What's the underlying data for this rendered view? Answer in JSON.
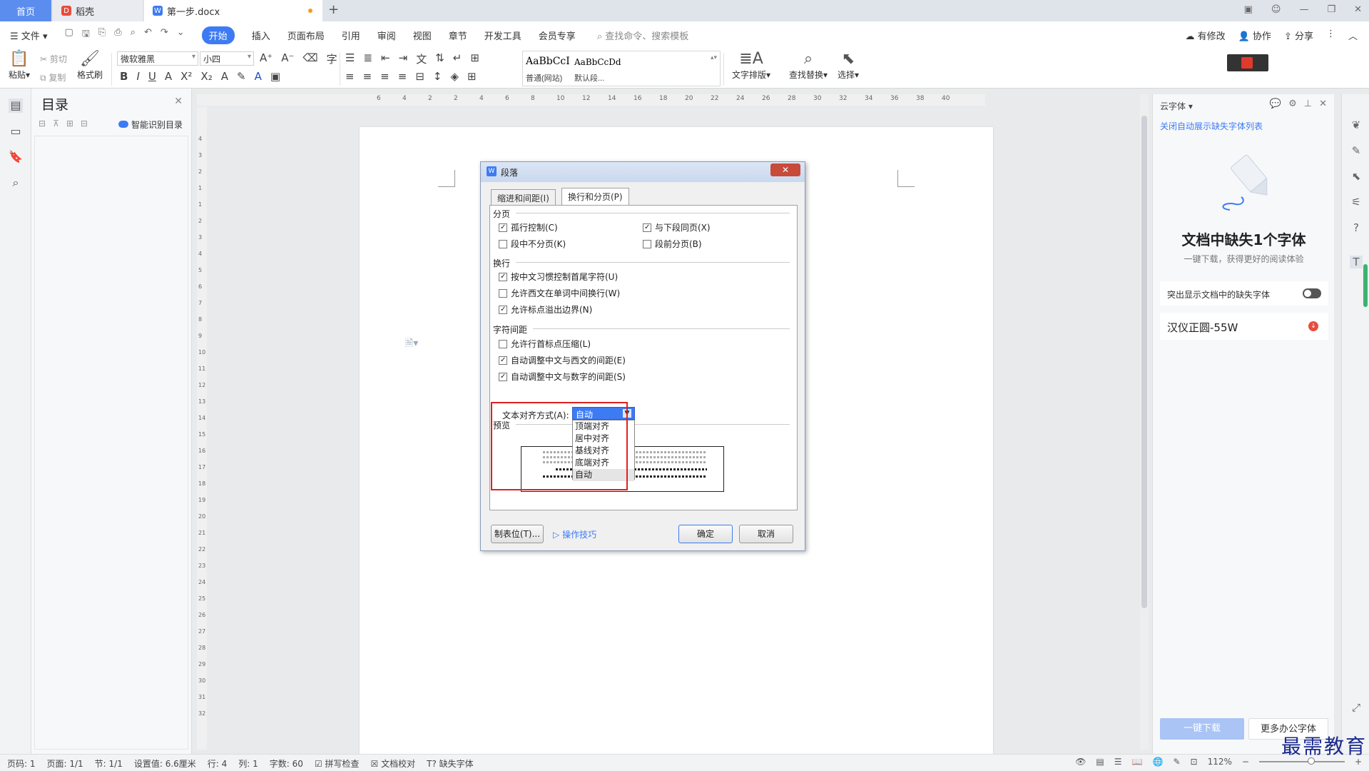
{
  "tabs": {
    "home": "首页",
    "shell": "稻壳",
    "doc": "第一步.docx",
    "add": "+"
  },
  "menu": {
    "file": "文件",
    "items": [
      "开始",
      "插入",
      "页面布局",
      "引用",
      "审阅",
      "视图",
      "章节",
      "开发工具",
      "会员专享"
    ],
    "active": "开始",
    "search_placeholder": "查找命令、搜索模板",
    "right": {
      "modified": "有修改",
      "collab": "协作",
      "share": "分享"
    }
  },
  "ribbon": {
    "paste": "粘贴",
    "cut": "剪切",
    "copy": "复制",
    "format_painter": "格式刷",
    "font_name": "微软雅黑",
    "font_size": "小四",
    "bold": "B",
    "italic": "I",
    "underline": "U",
    "styles": [
      {
        "sample": "AaBbCcI",
        "name": "普通(网站)"
      },
      {
        "sample": "AaBbCcDd",
        "name": "默认段..."
      }
    ],
    "text_layout": "文字排版",
    "find_replace": "查找替换",
    "select": "选择"
  },
  "toc": {
    "title": "目录",
    "smart": "智能识别目录"
  },
  "ruler_h": [
    "6",
    "4",
    "2",
    "2",
    "4",
    "6",
    "8",
    "10",
    "12",
    "14",
    "16",
    "18",
    "20",
    "22",
    "24",
    "26",
    "28",
    "30",
    "32",
    "34",
    "36",
    "38",
    "40"
  ],
  "ruler_v": [
    "4",
    "3",
    "2",
    "1",
    "1",
    "2",
    "3",
    "4",
    "5",
    "6",
    "7",
    "8",
    "9",
    "10",
    "11",
    "12",
    "13",
    "14",
    "15",
    "16",
    "17",
    "18",
    "19",
    "20",
    "21",
    "22",
    "23",
    "24",
    "25",
    "26",
    "27",
    "28",
    "29",
    "30",
    "31",
    "32"
  ],
  "dialog": {
    "title": "段落",
    "close": "✕",
    "tabs": [
      "缩进和间距(I)",
      "换行和分页(P)"
    ],
    "sections": {
      "pagination": "分页",
      "linebreak": "换行",
      "charspacing": "字符间距",
      "preview": "预览"
    },
    "checks": {
      "widow": {
        "label": "孤行控制(C)",
        "checked": true
      },
      "keep_next": {
        "label": "与下段同页(X)",
        "checked": true
      },
      "keep_lines": {
        "label": "段中不分页(K)",
        "checked": false
      },
      "page_before": {
        "label": "段前分页(B)",
        "checked": false
      },
      "cn_rules": {
        "label": "按中文习惯控制首尾字符(U)",
        "checked": true
      },
      "word_wrap": {
        "label": "允许西文在单词中间换行(W)",
        "checked": false
      },
      "punct_overflow": {
        "label": "允许标点溢出边界(N)",
        "checked": true
      },
      "compress_punct": {
        "label": "允许行首标点压缩(L)",
        "checked": false
      },
      "auto_cn_en": {
        "label": "自动调整中文与西文的间距(E)",
        "checked": true
      },
      "auto_cn_num": {
        "label": "自动调整中文与数字的间距(S)",
        "checked": true
      }
    },
    "align_label": "文本对齐方式(A):",
    "align_value": "自动",
    "align_options": [
      "顶端对齐",
      "居中对齐",
      "基线对齐",
      "底端对齐",
      "自动"
    ],
    "buttons": {
      "tabs": "制表位(T)...",
      "tips": "操作技巧",
      "ok": "确定",
      "cancel": "取消"
    }
  },
  "right_panel": {
    "header": "云字体",
    "link": "关闭自动展示缺失字体列表",
    "title": "文档中缺失1个字体",
    "subtitle": "一键下载，获得更好的阅读体验",
    "toggle_label": "突出显示文档中的缺失字体",
    "font": "汉仪正圆-55W",
    "download_btn": "一键下载",
    "more_btn": "更多办公字体"
  },
  "status": {
    "page_no": "页码: 1",
    "pages": "页面: 1/1",
    "section": "节: 1/1",
    "setting": "设置值: 6.6厘米",
    "row": "行: 4",
    "col": "列: 1",
    "words": "字数: 60",
    "spell": "拼写检查",
    "proof": "文档校对",
    "missing_font": "缺失字体",
    "zoom": "112%"
  },
  "watermark": "最需教育"
}
